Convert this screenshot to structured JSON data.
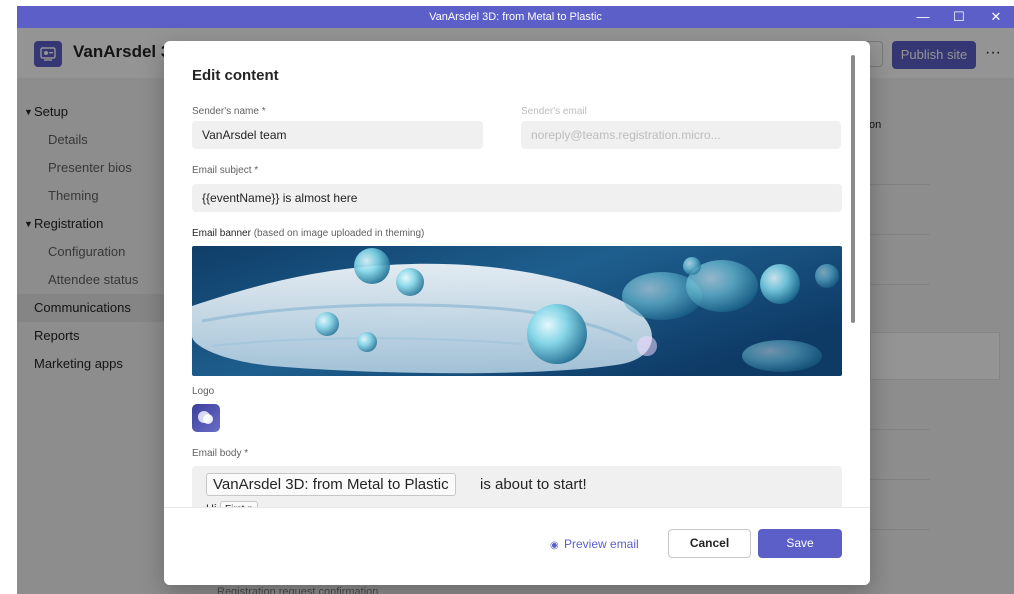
{
  "window": {
    "title": "VanArsdel 3D: from Metal to Plastic",
    "minimize": "—",
    "maximize": "☐",
    "close": "✕"
  },
  "app": {
    "title": "VanArsdel 3D",
    "publish_label": "Publish site",
    "more_label": "···"
  },
  "sidebar": {
    "groups": [
      {
        "label": "Setup",
        "children": [
          "Details",
          "Presenter bios",
          "Theming"
        ]
      },
      {
        "label": "Registration",
        "children": [
          "Configuration",
          "Attendee status"
        ]
      }
    ],
    "items": [
      "Communications",
      "Reports",
      "Marketing apps"
    ],
    "selected": "Communications"
  },
  "background": {
    "fragment_text": "on",
    "bottom_text": "Registration request confirmation"
  },
  "modal": {
    "title": "Edit content",
    "sender_name": {
      "label": "Sender's name *",
      "value": "VanArsdel team"
    },
    "sender_email": {
      "label": "Sender's email",
      "value": "noreply@teams.registration.micro..."
    },
    "subject": {
      "label": "Email subject *",
      "value": "{{eventName}} is almost here"
    },
    "banner": {
      "label": "Email banner",
      "note": "(based on image uploaded in theming)"
    },
    "logo": {
      "label": "Logo"
    },
    "body": {
      "label": "Email body *",
      "token_event": "VanArsdel 3D: from Metal to Plastic",
      "text_after": "is about to start!",
      "greeting": "Hi",
      "token_first": "First n"
    },
    "preview_label": "Preview email",
    "cancel_label": "Cancel",
    "save_label": "Save"
  },
  "colors": {
    "accent": "#5b5fc7",
    "titlebar": "#5b5fc7"
  }
}
